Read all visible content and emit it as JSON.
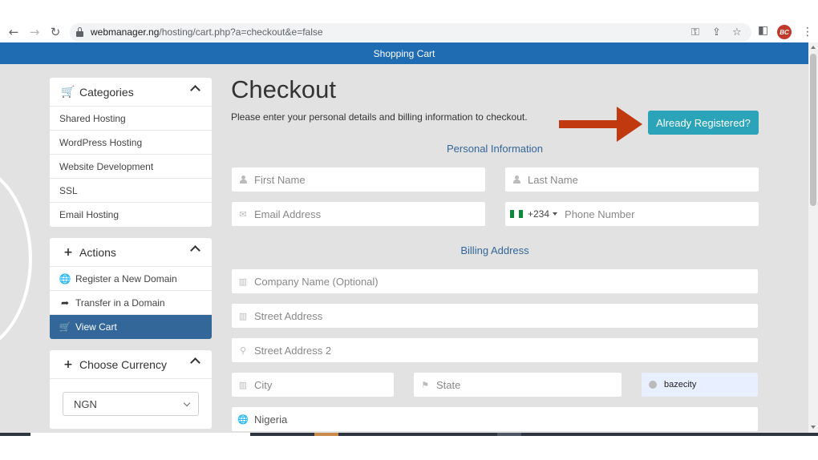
{
  "browser": {
    "url_host": "webmanager.ng",
    "url_path": "/hosting/cart.php?a=checkout&e=false",
    "profile_initials": "BC"
  },
  "banner": {
    "title": "Shopping Cart"
  },
  "sidebar": {
    "categories": {
      "title": "Categories",
      "items": [
        {
          "label": "Shared Hosting"
        },
        {
          "label": "WordPress Hosting"
        },
        {
          "label": "Website Development"
        },
        {
          "label": "SSL"
        },
        {
          "label": "Email Hosting"
        }
      ]
    },
    "actions": {
      "title": "Actions",
      "items": [
        {
          "label": "Register a New Domain",
          "icon": "globe-icon"
        },
        {
          "label": "Transfer in a Domain",
          "icon": "share-arrow-icon"
        },
        {
          "label": "View Cart",
          "icon": "cart-icon",
          "active": true
        }
      ]
    },
    "currency": {
      "title": "Choose Currency",
      "selected": "NGN"
    }
  },
  "main": {
    "title": "Checkout",
    "subtitle": "Please enter your personal details and billing information to checkout.",
    "already_registered": "Already Registered?",
    "personal_info_title": "Personal Information",
    "billing_title": "Billing Address",
    "fields": {
      "first_name": "First Name",
      "last_name": "Last Name",
      "email": "Email Address",
      "dial_code": "+234",
      "phone": "Phone Number",
      "company": "Company Name (Optional)",
      "street": "Street Address",
      "street2": "Street Address 2",
      "city": "City",
      "state": "State",
      "autofill_value": "bazecity",
      "country": "Nigeria"
    }
  },
  "colors": {
    "accent_blue": "#1f6cb3",
    "section_blue": "#336699",
    "button_teal": "#2ba3b8",
    "arrow_red": "#c0390f",
    "page_bg": "#e2e2e2"
  }
}
